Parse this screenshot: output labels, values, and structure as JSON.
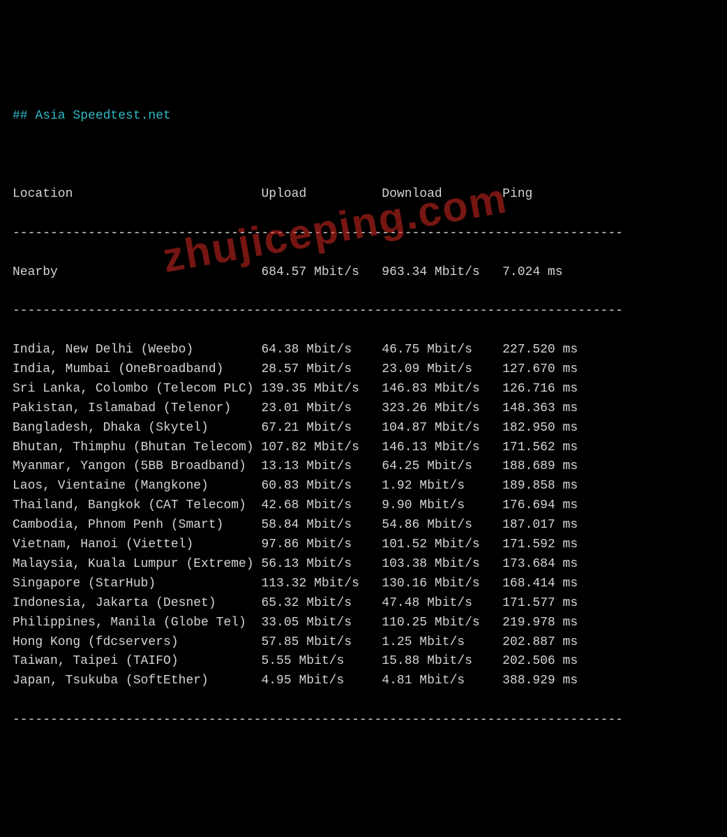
{
  "title": "## Asia Speedtest.net",
  "columns": {
    "location": "Location",
    "upload": "Upload",
    "download": "Download",
    "ping": "Ping"
  },
  "separator": "---------------------------------------------------------------------------------",
  "nearby": {
    "location": "Nearby",
    "upload": "684.57 Mbit/s",
    "download": "963.34 Mbit/s",
    "ping": "7.024 ms"
  },
  "rows": [
    {
      "location": "India, New Delhi (Weebo)",
      "upload": "64.38 Mbit/s",
      "download": "46.75 Mbit/s",
      "ping": "227.520 ms"
    },
    {
      "location": "India, Mumbai (OneBroadband)",
      "upload": "28.57 Mbit/s",
      "download": "23.09 Mbit/s",
      "ping": "127.670 ms"
    },
    {
      "location": "Sri Lanka, Colombo (Telecom PLC)",
      "upload": "139.35 Mbit/s",
      "download": "146.83 Mbit/s",
      "ping": "126.716 ms"
    },
    {
      "location": "Pakistan, Islamabad (Telenor)",
      "upload": "23.01 Mbit/s",
      "download": "323.26 Mbit/s",
      "ping": "148.363 ms"
    },
    {
      "location": "Bangladesh, Dhaka (Skytel)",
      "upload": "67.21 Mbit/s",
      "download": "104.87 Mbit/s",
      "ping": "182.950 ms"
    },
    {
      "location": "Bhutan, Thimphu (Bhutan Telecom)",
      "upload": "107.82 Mbit/s",
      "download": "146.13 Mbit/s",
      "ping": "171.562 ms"
    },
    {
      "location": "Myanmar, Yangon (5BB Broadband)",
      "upload": "13.13 Mbit/s",
      "download": "64.25 Mbit/s",
      "ping": "188.689 ms"
    },
    {
      "location": "Laos, Vientaine (Mangkone)",
      "upload": "60.83 Mbit/s",
      "download": "1.92 Mbit/s",
      "ping": "189.858 ms"
    },
    {
      "location": "Thailand, Bangkok (CAT Telecom)",
      "upload": "42.68 Mbit/s",
      "download": "9.90 Mbit/s",
      "ping": "176.694 ms"
    },
    {
      "location": "Cambodia, Phnom Penh (Smart)",
      "upload": "58.84 Mbit/s",
      "download": "54.86 Mbit/s",
      "ping": "187.017 ms"
    },
    {
      "location": "Vietnam, Hanoi (Viettel)",
      "upload": "97.86 Mbit/s",
      "download": "101.52 Mbit/s",
      "ping": "171.592 ms"
    },
    {
      "location": "Malaysia, Kuala Lumpur (Extreme)",
      "upload": "56.13 Mbit/s",
      "download": "103.38 Mbit/s",
      "ping": "173.684 ms"
    },
    {
      "location": "Singapore (StarHub)",
      "upload": "113.32 Mbit/s",
      "download": "130.16 Mbit/s",
      "ping": "168.414 ms"
    },
    {
      "location": "Indonesia, Jakarta (Desnet)",
      "upload": "65.32 Mbit/s",
      "download": "47.48 Mbit/s",
      "ping": "171.577 ms"
    },
    {
      "location": "Philippines, Manila (Globe Tel)",
      "upload": "33.05 Mbit/s",
      "download": "110.25 Mbit/s",
      "ping": "219.978 ms"
    },
    {
      "location": "Hong Kong (fdcservers)",
      "upload": "57.85 Mbit/s",
      "download": "1.25 Mbit/s",
      "ping": "202.887 ms"
    },
    {
      "location": "Taiwan, Taipei (TAIFO)",
      "upload": "5.55 Mbit/s",
      "download": "15.88 Mbit/s",
      "ping": "202.506 ms"
    },
    {
      "location": "Japan, Tsukuba (SoftEther)",
      "upload": "4.95 Mbit/s",
      "download": "4.81 Mbit/s",
      "ping": "388.929 ms"
    }
  ],
  "watermark": "zhujiceping.com",
  "col_widths": {
    "location": 33,
    "upload": 16,
    "download": 16,
    "ping": 12
  }
}
